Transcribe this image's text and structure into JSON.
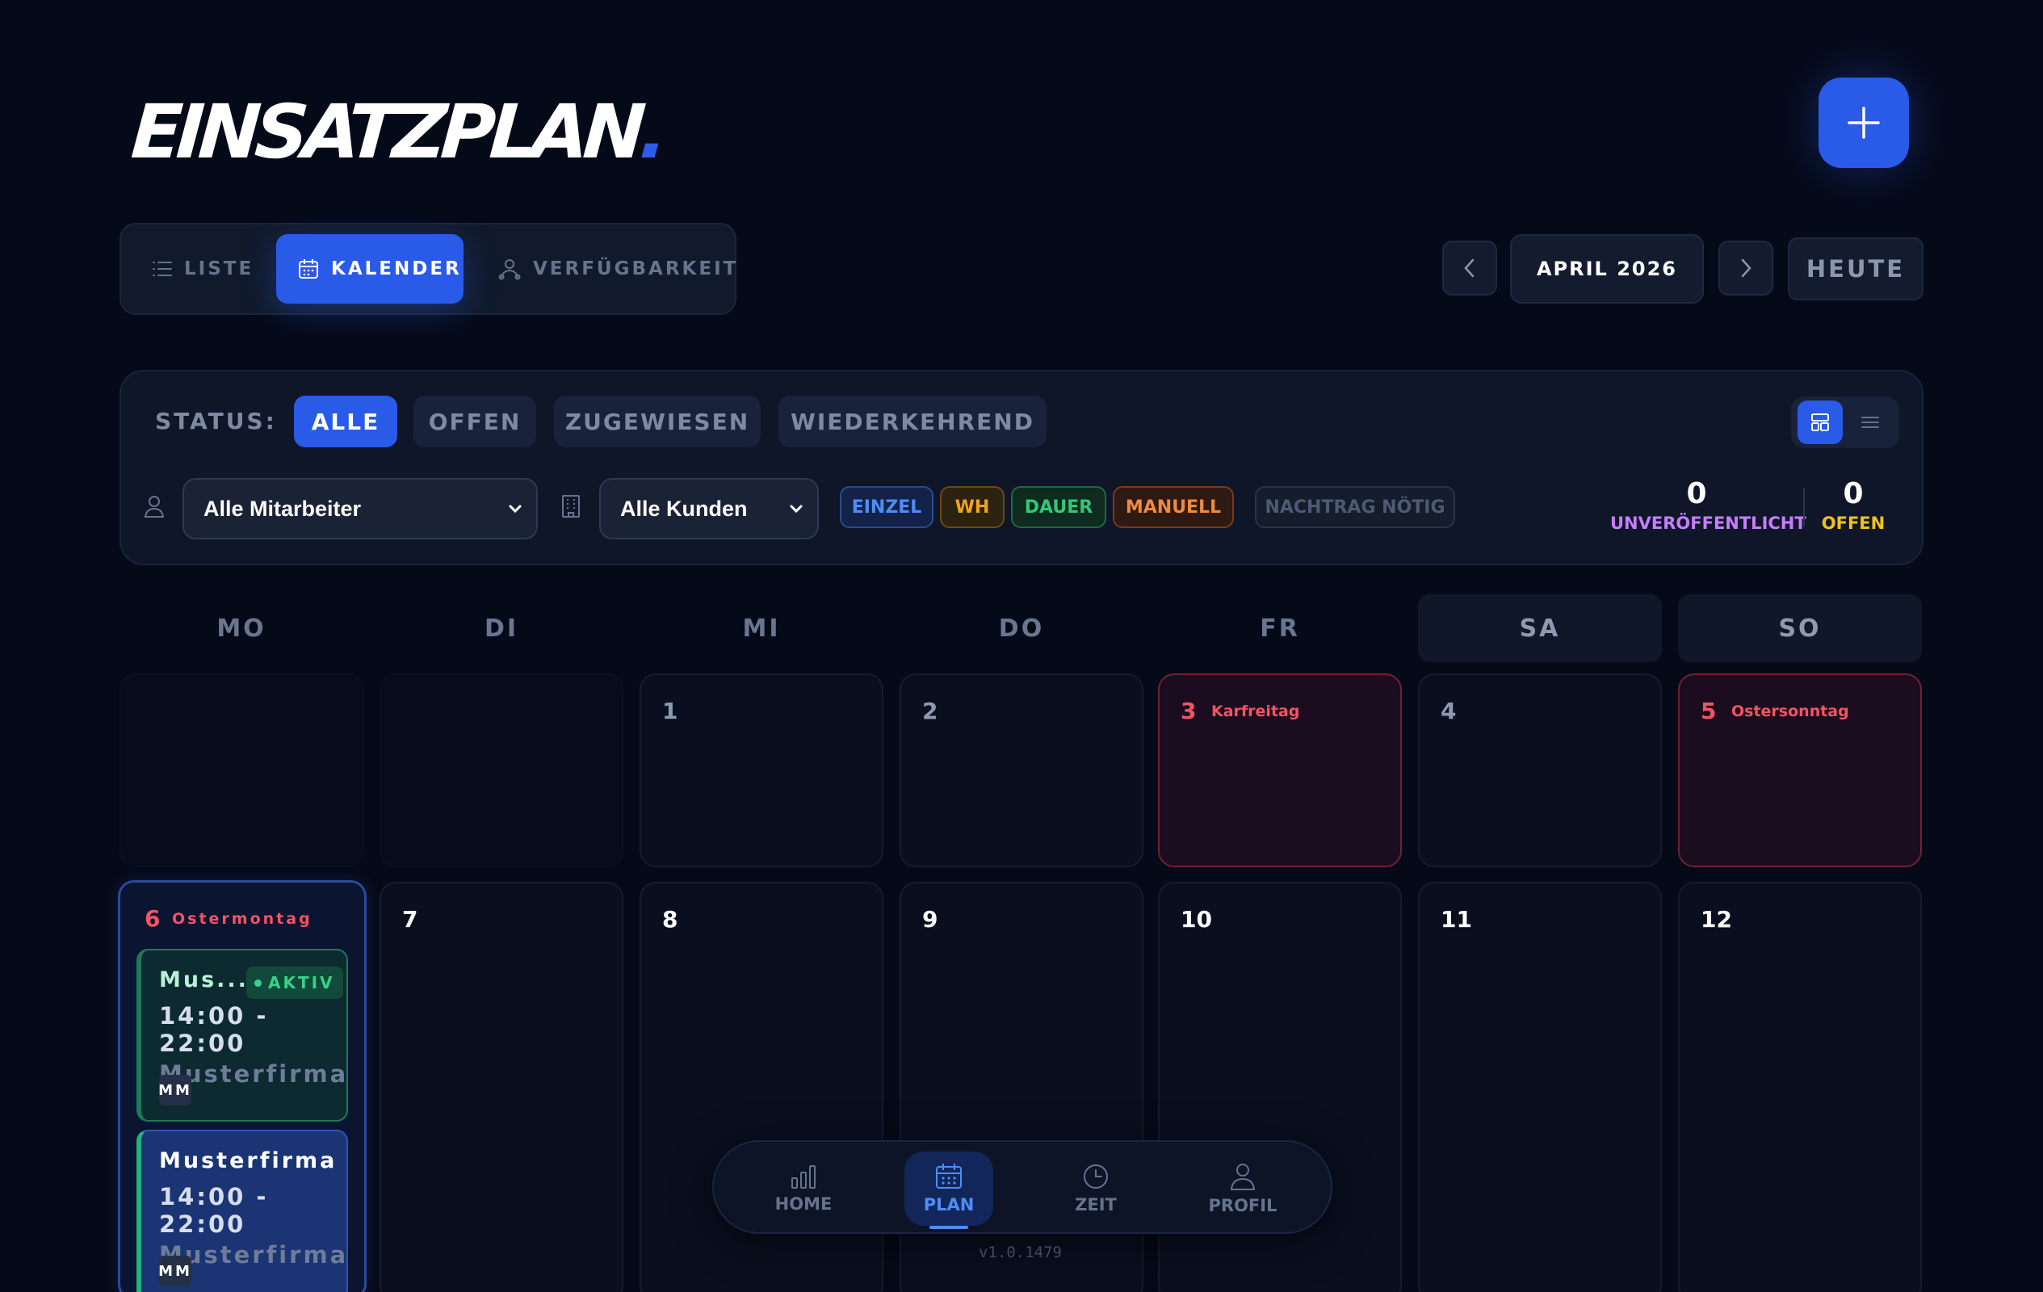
{
  "app": {
    "logo_text": "EINSATZPLAN",
    "logo_dot": ".",
    "accent_color": "#2a5ae8"
  },
  "view_tabs": [
    {
      "label": "LISTE",
      "icon": "list-icon"
    },
    {
      "label": "KALENDER",
      "icon": "calendar-icon",
      "active": true
    },
    {
      "label": "VERFÜGBARKEIT",
      "icon": "user-availability-icon"
    }
  ],
  "month_nav": {
    "month_label": "APRIL 2026",
    "today_label": "HEUTE"
  },
  "filters": {
    "status_label": "STATUS:",
    "status_options": [
      "ALLE",
      "OFFEN",
      "ZUGEWIESEN",
      "WIEDERKEHREND"
    ],
    "status_selected": "ALLE",
    "employee_select": "Alle Mitarbeiter",
    "customer_select": "Alle Kunden",
    "tags": [
      "EINZEL",
      "WH",
      "DAUER",
      "MANUELL"
    ],
    "nachtrag_tag": "NACHTRAG NÖTIG",
    "view_mode": "grid"
  },
  "counters": [
    {
      "value": "0",
      "label": "UNVERÖFFENTLICHT",
      "color": "#c77dff"
    },
    {
      "value": "0",
      "label": "OFFEN",
      "color": "#f2c21c"
    }
  ],
  "calendar": {
    "weekdays": [
      "MO",
      "DI",
      "MI",
      "DO",
      "FR",
      "SA",
      "SO"
    ],
    "row1": [
      {
        "day": "",
        "holiday": ""
      },
      {
        "day": "",
        "holiday": ""
      },
      {
        "day": "1",
        "holiday": ""
      },
      {
        "day": "2",
        "holiday": ""
      },
      {
        "day": "3",
        "holiday": "Karfreitag"
      },
      {
        "day": "4",
        "holiday": ""
      },
      {
        "day": "5",
        "holiday": "Ostersonntag"
      }
    ],
    "row2": [
      {
        "day": "6",
        "holiday": "Ostermontag"
      },
      {
        "day": "7"
      },
      {
        "day": "8"
      },
      {
        "day": "9"
      },
      {
        "day": "10"
      },
      {
        "day": "11"
      },
      {
        "day": "12"
      }
    ],
    "shifts": [
      {
        "title": "Mus...",
        "badge": "AKTIV",
        "time": "14:00 - 22:00",
        "company": "Musterfirma",
        "initials": "MM"
      },
      {
        "title": "Musterfirma",
        "time": "14:00 - 22:00",
        "company": "Musterfirma",
        "initials": "MM"
      }
    ]
  },
  "bottom_nav": [
    {
      "label": "HOME",
      "icon": "chart-bars-icon"
    },
    {
      "label": "PLAN",
      "icon": "calendar-icon",
      "active": true
    },
    {
      "label": "ZEIT",
      "icon": "clock-icon"
    },
    {
      "label": "PROFIL",
      "icon": "user-icon"
    }
  ],
  "version": "v1.0.1479"
}
